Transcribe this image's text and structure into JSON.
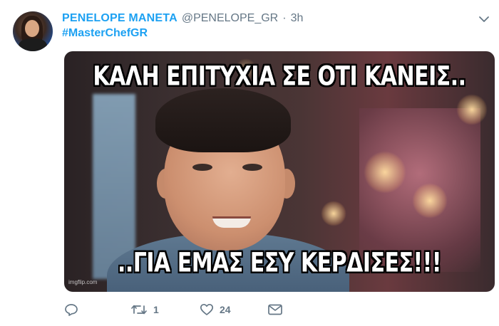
{
  "tweet": {
    "author_name": "PENELOPE MANETA",
    "author_handle": "@PENELOPE_GR",
    "separator": "·",
    "time": "3h",
    "hashtag": "#MasterChefGR",
    "media": {
      "top_caption": "ΚΑΛΗ ΕΠΙΤΥΧΙΑ ΣΕ ΟΤΙ ΚΑΝΕΙΣ..",
      "bottom_caption": "..ΓΙΑ ΕΜΑΣ ΕΣΥ ΚΕΡΔΙΣΕΣ!!!",
      "watermark": "imgflip.com"
    },
    "actions": {
      "reply_count": "",
      "retweet_count": "1",
      "like_count": "24"
    }
  },
  "icons": {
    "avatar": "avatar",
    "more": "chevron-down-icon",
    "reply": "reply-icon",
    "retweet": "retweet-icon",
    "like": "heart-icon",
    "dm": "envelope-icon"
  },
  "colors": {
    "link": "#1da1f2",
    "secondary_text": "#657786",
    "icon": "#657786"
  }
}
